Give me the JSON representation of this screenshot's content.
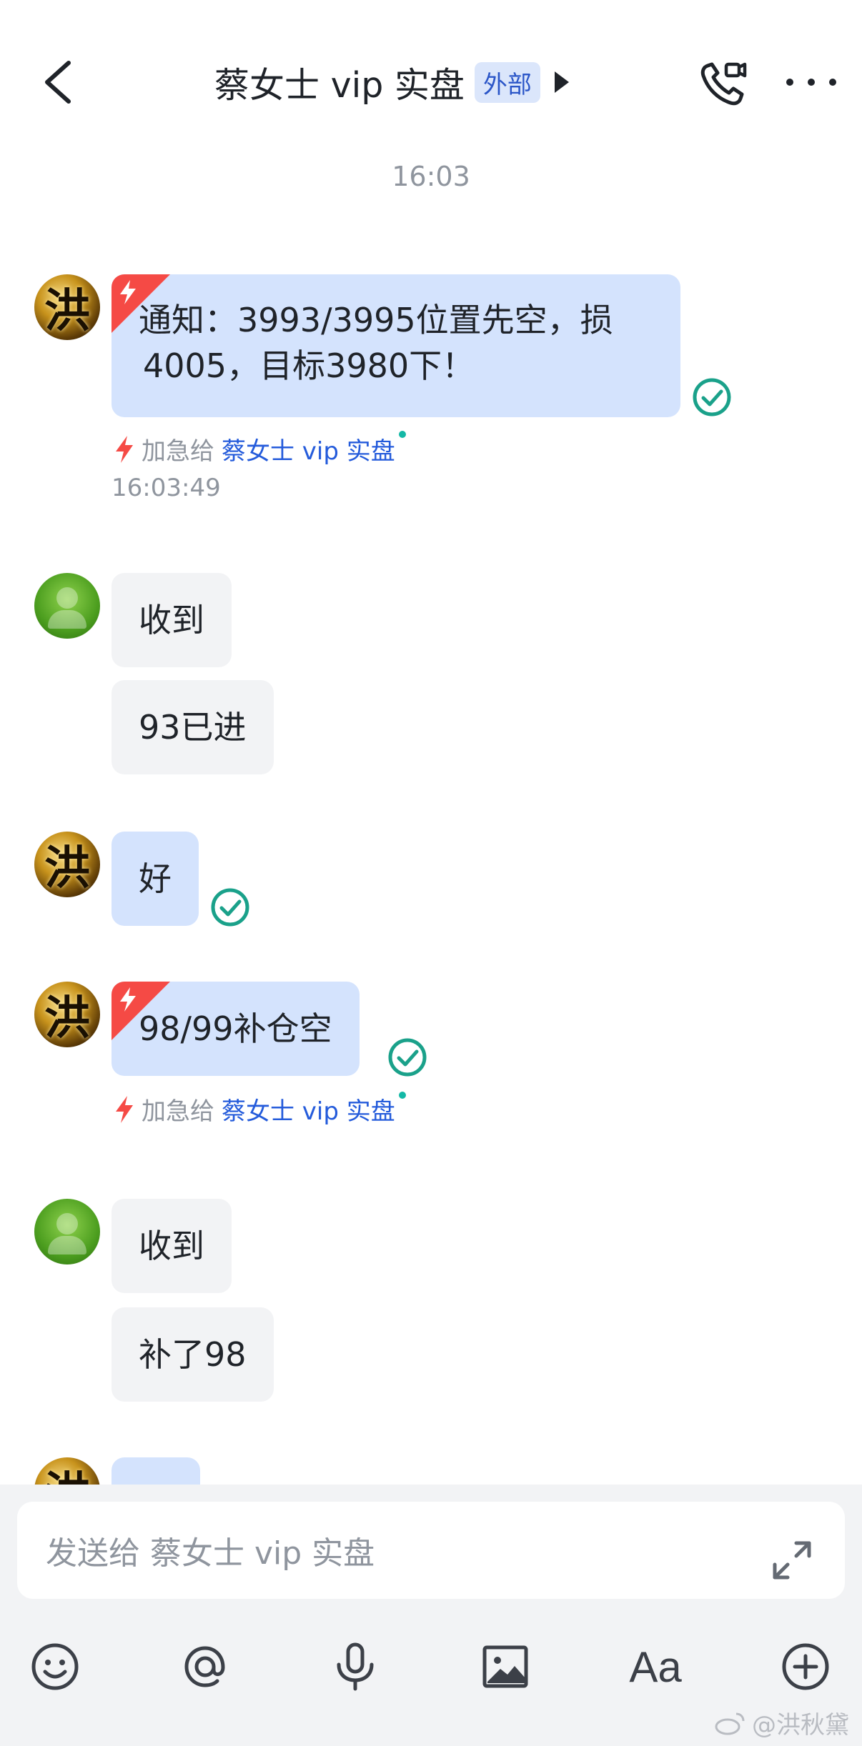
{
  "header": {
    "title": "蔡女士 vip 实盘",
    "badge": "外部"
  },
  "time_divider": "16:03",
  "messages": [
    {
      "text_line1": "通知：3993/3995位置先空，损",
      "text_line2": "4005，目标3980下！",
      "urgent": true,
      "read": true
    },
    {
      "urgent_label": "加急给",
      "urgent_target": "蔡女士 vip 实盘",
      "timestamp": "16:03:49"
    },
    {
      "text": "收到"
    },
    {
      "text": "93已进"
    },
    {
      "text": "好",
      "read": true
    },
    {
      "text": "98/99补仓空",
      "urgent": true,
      "read": true
    },
    {
      "urgent_label": "加急给",
      "urgent_target": "蔡女士 vip 实盘"
    },
    {
      "text": "收到"
    },
    {
      "text": "补了98"
    }
  ],
  "composer": {
    "placeholder": "发送给 蔡女士 vip 实盘",
    "font_button": "Aa"
  },
  "watermark": "@洪秋黛",
  "colors": {
    "bubble_self": "#d4e3fd",
    "bubble_other": "#f2f3f5",
    "urgent": "#f54a45",
    "read_check": "#1aa18a",
    "link": "#245bdb"
  }
}
